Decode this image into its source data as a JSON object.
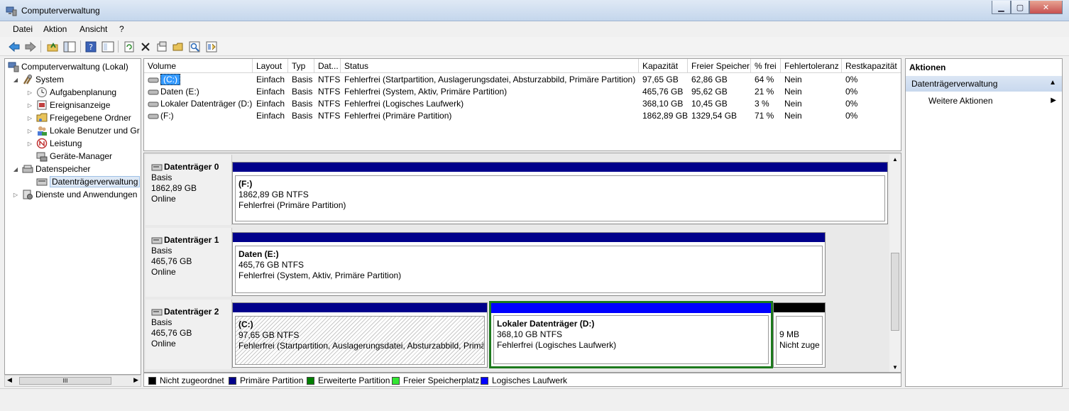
{
  "window": {
    "title": "Computerverwaltung"
  },
  "menu": {
    "datei": "Datei",
    "aktion": "Aktion",
    "ansicht": "Ansicht",
    "help": "?"
  },
  "tree": {
    "root": "Computerverwaltung (Lokal)",
    "system": "System",
    "aufgabenplanung": "Aufgabenplanung",
    "ereignisanzeige": "Ereignisanzeige",
    "freigegebene_ordner": "Freigegebene Ordner",
    "lokale_benutzer": "Lokale Benutzer und Gr",
    "leistung": "Leistung",
    "geraete_manager": "Geräte-Manager",
    "datenspeicher": "Datenspeicher",
    "datentraegerverwaltung": "Datenträgerverwaltung",
    "dienste": "Dienste und Anwendungen",
    "hscroll_thumb": "III"
  },
  "volumes": {
    "headers": [
      "Volume",
      "Layout",
      "Typ",
      "Dat...",
      "Status",
      "Kapazität",
      "Freier Speicher",
      "% frei",
      "Fehlertoleranz",
      "Restkapazität"
    ],
    "rows": [
      [
        "(C:)",
        "Einfach",
        "Basis",
        "NTFS",
        "Fehlerfrei (Startpartition, Auslagerungsdatei, Absturzabbild, Primäre Partition)",
        "97,65 GB",
        "62,86 GB",
        "64 %",
        "Nein",
        "0%"
      ],
      [
        "Daten (E:)",
        "Einfach",
        "Basis",
        "NTFS",
        "Fehlerfrei (System, Aktiv, Primäre Partition)",
        "465,76 GB",
        "95,62 GB",
        "21 %",
        "Nein",
        "0%"
      ],
      [
        "Lokaler Datenträger (D:)",
        "Einfach",
        "Basis",
        "NTFS",
        "Fehlerfrei (Logisches Laufwerk)",
        "368,10 GB",
        "10,45 GB",
        "3 %",
        "Nein",
        "0%"
      ],
      [
        "(F:)",
        "Einfach",
        "Basis",
        "NTFS",
        "Fehlerfrei (Primäre Partition)",
        "1862,89 GB",
        "1329,54 GB",
        "71 %",
        "Nein",
        "0%"
      ]
    ]
  },
  "disks": [
    {
      "name": "Datenträger 0",
      "type": "Basis",
      "size": "1862,89 GB",
      "state": "Online",
      "partitions": [
        {
          "name": "(F:)",
          "size": "1862,89 GB NTFS",
          "status": "Fehlerfrei (Primäre Partition)"
        }
      ]
    },
    {
      "name": "Datenträger 1",
      "type": "Basis",
      "size": "465,76 GB",
      "state": "Online",
      "partitions": [
        {
          "name": "Daten  (E:)",
          "size": "465,76 GB NTFS",
          "status": "Fehlerfrei (System, Aktiv, Primäre Partition)"
        }
      ]
    },
    {
      "name": "Datenträger 2",
      "type": "Basis",
      "size": "465,76 GB",
      "state": "Online",
      "partitions": [
        {
          "name": "(C:)",
          "size": "97,65 GB NTFS",
          "status": "Fehlerfrei (Startpartition, Auslagerungsdatei, Absturzabbild, Primä"
        },
        {
          "name": "Lokaler Datenträger  (D:)",
          "size": "368,10 GB NTFS",
          "status": "Fehlerfrei (Logisches Laufwerk)"
        },
        {
          "name": "",
          "size": "9 MB",
          "status": "Nicht zuge"
        }
      ]
    }
  ],
  "legend": [
    {
      "label": "Nicht zugeordnet",
      "color": "#000000"
    },
    {
      "label": "Primäre Partition",
      "color": "#00008b"
    },
    {
      "label": "Erweiterte Partition",
      "color": "#008000"
    },
    {
      "label": "Freier Speicherplatz",
      "color": "#33e633"
    },
    {
      "label": "Logisches Laufwerk",
      "color": "#0000ff"
    }
  ],
  "actions": {
    "header": "Aktionen",
    "section": "Datenträgerverwaltung",
    "more": "Weitere Aktionen"
  },
  "icons": {
    "back": "back-arrow-icon",
    "forward": "forward-arrow-icon",
    "up": "folder-up-icon",
    "tree": "show-tree-icon",
    "help": "help-icon",
    "console": "console-icon",
    "refresh": "refresh-icon",
    "delete": "delete-icon",
    "properties": "properties-icon",
    "open": "open-icon",
    "search": "search-icon",
    "wizard": "wizard-icon"
  },
  "colors": {
    "primary_partition": "#00008b",
    "logical_drive": "#0000ff",
    "extended_partition": "#008000",
    "unallocated": "#000000",
    "selection": "#3399ff"
  }
}
